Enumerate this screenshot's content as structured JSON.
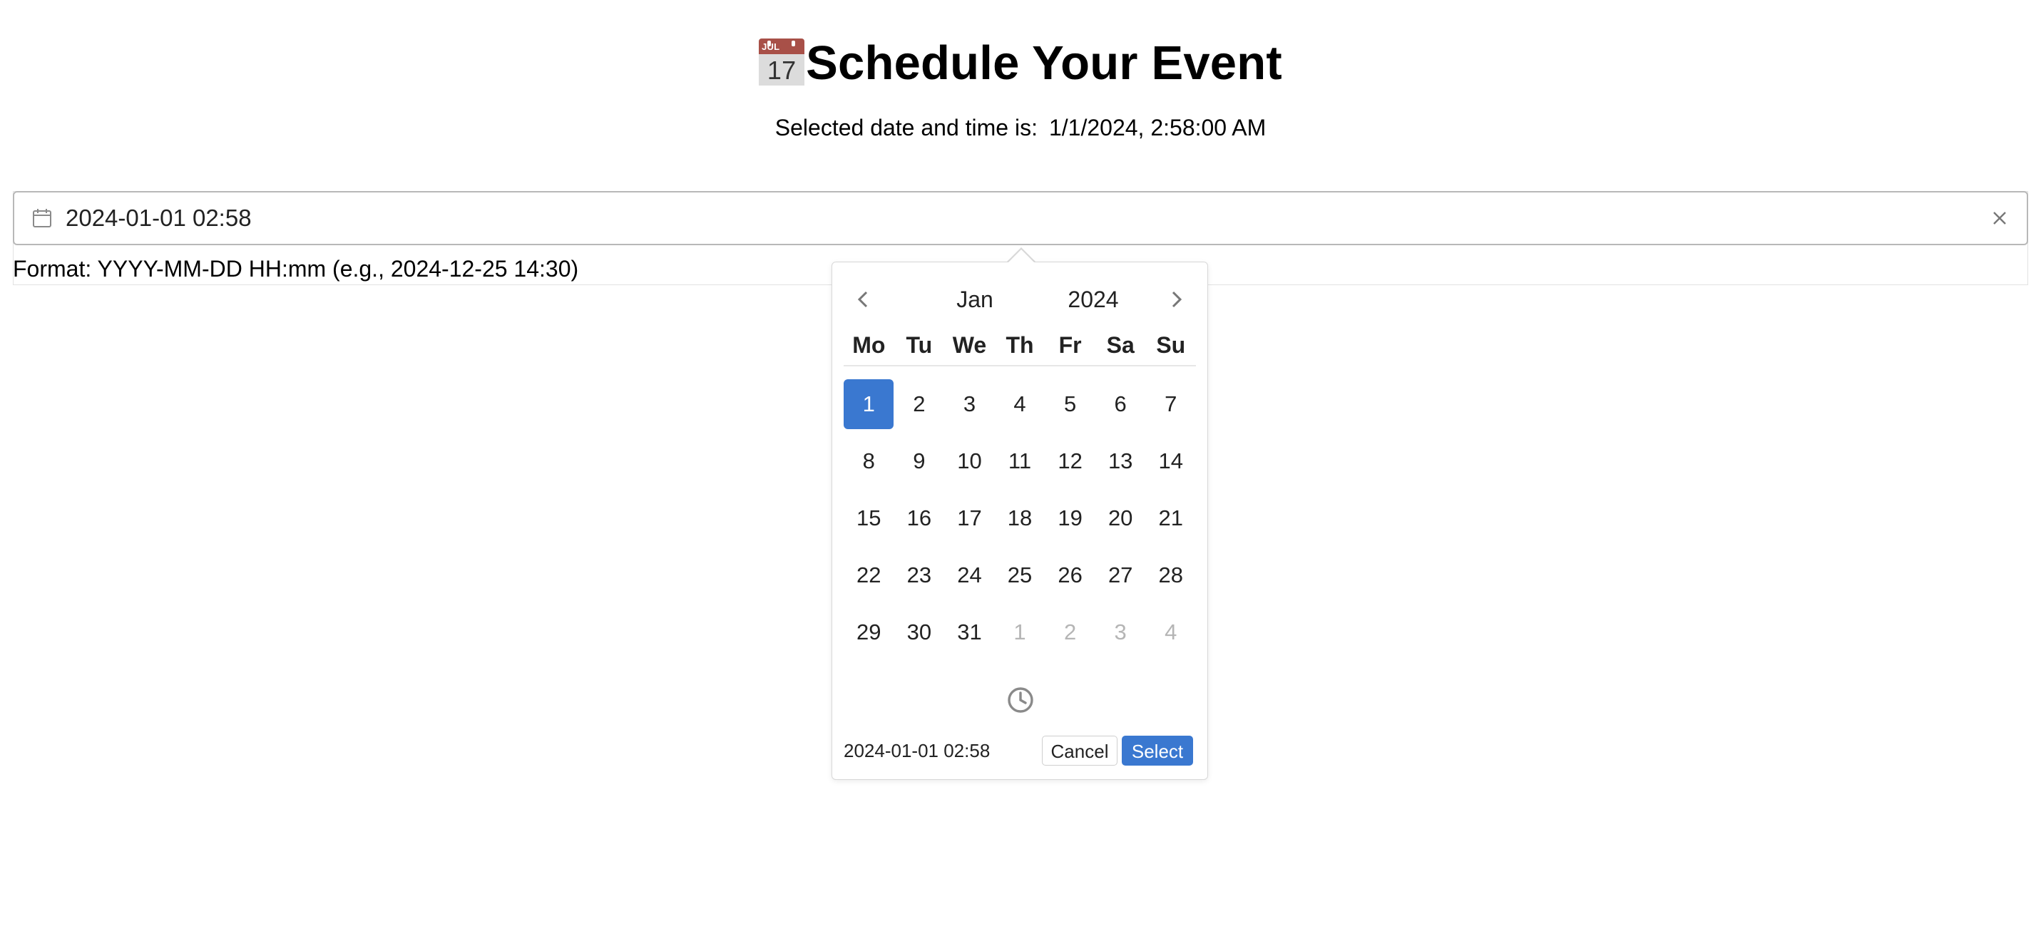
{
  "header": {
    "title": "Schedule Your Event",
    "calendar_emoji": {
      "month": "JUL",
      "day": "17"
    },
    "subtitle_label": "Selected date and time is:",
    "subtitle_value": "1/1/2024, 2:58:00 AM"
  },
  "input": {
    "value": "2024-01-01 02:58",
    "format_hint": "Format: YYYY-MM-DD HH:mm (e.g., 2024-12-25 14:30)"
  },
  "picker": {
    "month": "Jan",
    "year": "2024",
    "weekdays": [
      "Mo",
      "Tu",
      "We",
      "Th",
      "Fr",
      "Sa",
      "Su"
    ],
    "weeks": [
      [
        {
          "d": "1",
          "other": false,
          "selected": true
        },
        {
          "d": "2"
        },
        {
          "d": "3"
        },
        {
          "d": "4"
        },
        {
          "d": "5"
        },
        {
          "d": "6"
        },
        {
          "d": "7"
        }
      ],
      [
        {
          "d": "8"
        },
        {
          "d": "9"
        },
        {
          "d": "10"
        },
        {
          "d": "11"
        },
        {
          "d": "12"
        },
        {
          "d": "13"
        },
        {
          "d": "14"
        }
      ],
      [
        {
          "d": "15"
        },
        {
          "d": "16"
        },
        {
          "d": "17"
        },
        {
          "d": "18"
        },
        {
          "d": "19"
        },
        {
          "d": "20"
        },
        {
          "d": "21"
        }
      ],
      [
        {
          "d": "22"
        },
        {
          "d": "23"
        },
        {
          "d": "24"
        },
        {
          "d": "25"
        },
        {
          "d": "26"
        },
        {
          "d": "27"
        },
        {
          "d": "28"
        }
      ],
      [
        {
          "d": "29"
        },
        {
          "d": "30"
        },
        {
          "d": "31"
        },
        {
          "d": "1",
          "other": true
        },
        {
          "d": "2",
          "other": true
        },
        {
          "d": "3",
          "other": true
        },
        {
          "d": "4",
          "other": true
        }
      ]
    ],
    "footer_value": "2024-01-01 02:58",
    "cancel_label": "Cancel",
    "select_label": "Select"
  },
  "colors": {
    "accent": "#3a78d0",
    "muted_day": "#b5b5b5",
    "emoji_red": "#a85048"
  },
  "icons": {
    "input_prefix": "calendar-icon",
    "input_suffix": "close-icon",
    "prev": "chevron-left-icon",
    "next": "chevron-right-icon",
    "time_toggle": "clock-icon"
  }
}
